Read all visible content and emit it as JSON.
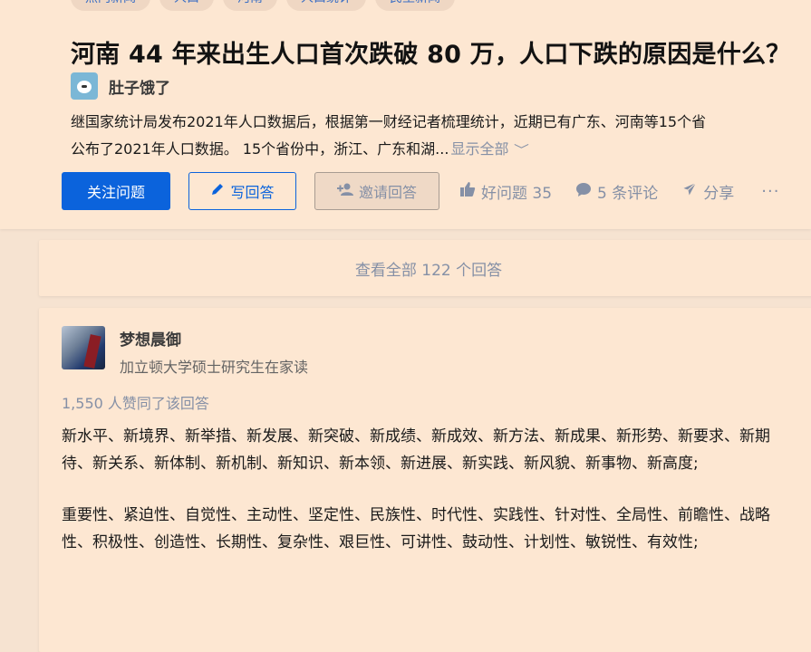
{
  "topics": [
    "热门新闻",
    "人口",
    "河南",
    "人口统计",
    "民生新闻"
  ],
  "question": {
    "title": "河南 44 年来出生人口首次跌破 80 万，人口下跌的原因是什么？",
    "asker_name": "肚子饿了",
    "desc_line1": "继国家统计局发布2021年人口数据后，根据第一财经记者梳理统计，近期已有广东、河南等15个省",
    "desc_line2": "公布了2021年人口数据。 15个省份中，浙江、广东和湖...",
    "show_all": "显示全部",
    "actions": {
      "follow": "关注问题",
      "write": "写回答",
      "invite": "邀请回答",
      "like": "好问题 35",
      "comments": "5 条评论",
      "share": "分享",
      "more": "···"
    }
  },
  "view_all_answers": "查看全部 122 个回答",
  "answer": {
    "author_name": "梦想晨御",
    "author_bio": "加立顿大学硕士研究生在家读",
    "votes": "1,550 人赞同了该回答",
    "paragraphs": [
      "新水平、新境界、新举措、新发展、新突破、新成绩、新成效、新方法、新成果、新形势、新要求、新期待、新关系、新体制、新机制、新知识、新本领、新进展、新实践、新风貌、新事物、新高度;",
      "重要性、紧迫性、自觉性、主动性、坚定性、民族性、时代性、实践性、针对性、全局性、前瞻性、战略性、积极性、创造性、长期性、复杂性、艰巨性、可讲性、鼓动性、计划性、敏锐性、有效性;"
    ]
  },
  "colors": {
    "page_bg": "#f6e3d1",
    "card_bg": "#fde7d2",
    "primary": "#0b63dc",
    "muted": "#8590a6",
    "topic_text": "#3b6fc4"
  },
  "icons": [
    "pencil-icon",
    "add-person-icon",
    "thumbs-up-icon",
    "comment-bubble-icon",
    "paper-plane-icon",
    "chevron-down-icon",
    "more-dots-icon"
  ]
}
